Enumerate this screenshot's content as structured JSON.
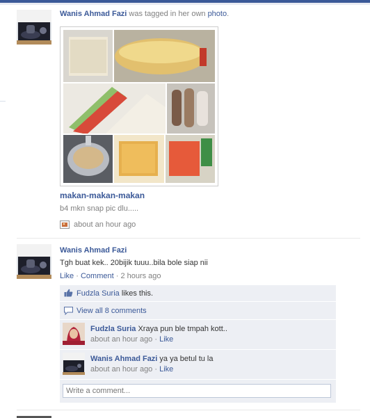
{
  "story1": {
    "author": "Wanis Ahmad Fazi",
    "action": " was tagged in her own ",
    "object": "photo",
    "period": ".",
    "album_title": "makan-makan-makan",
    "caption": "b4 mkn snap pic dlu.....",
    "time": "about an hour ago"
  },
  "story2": {
    "author": "Wanis Ahmad Fazi",
    "message": "Tgh buat kek.. 20bijik tuuu..bila bole siap nii",
    "like_link": "Like",
    "comment_link": "Comment",
    "dot": " · ",
    "time": "2 hours ago",
    "likes": {
      "name": "Fudzla Suria",
      "suffix": " likes this."
    },
    "view_all": "View all 8 comments",
    "comments": [
      {
        "author": "Fudzla Suria",
        "text": " Xraya pun ble tmpah kott..",
        "time": "about an hour ago",
        "like": "Like"
      },
      {
        "author": "Wanis Ahmad Fazi",
        "text": " ya ya betul tu la",
        "time": "about an hour ago",
        "like": "Like"
      }
    ],
    "input_placeholder": "Write a comment..."
  },
  "colors": {
    "link": "#3b5998",
    "ufi_background": "#edeff4",
    "meta_grey": "#808080"
  }
}
